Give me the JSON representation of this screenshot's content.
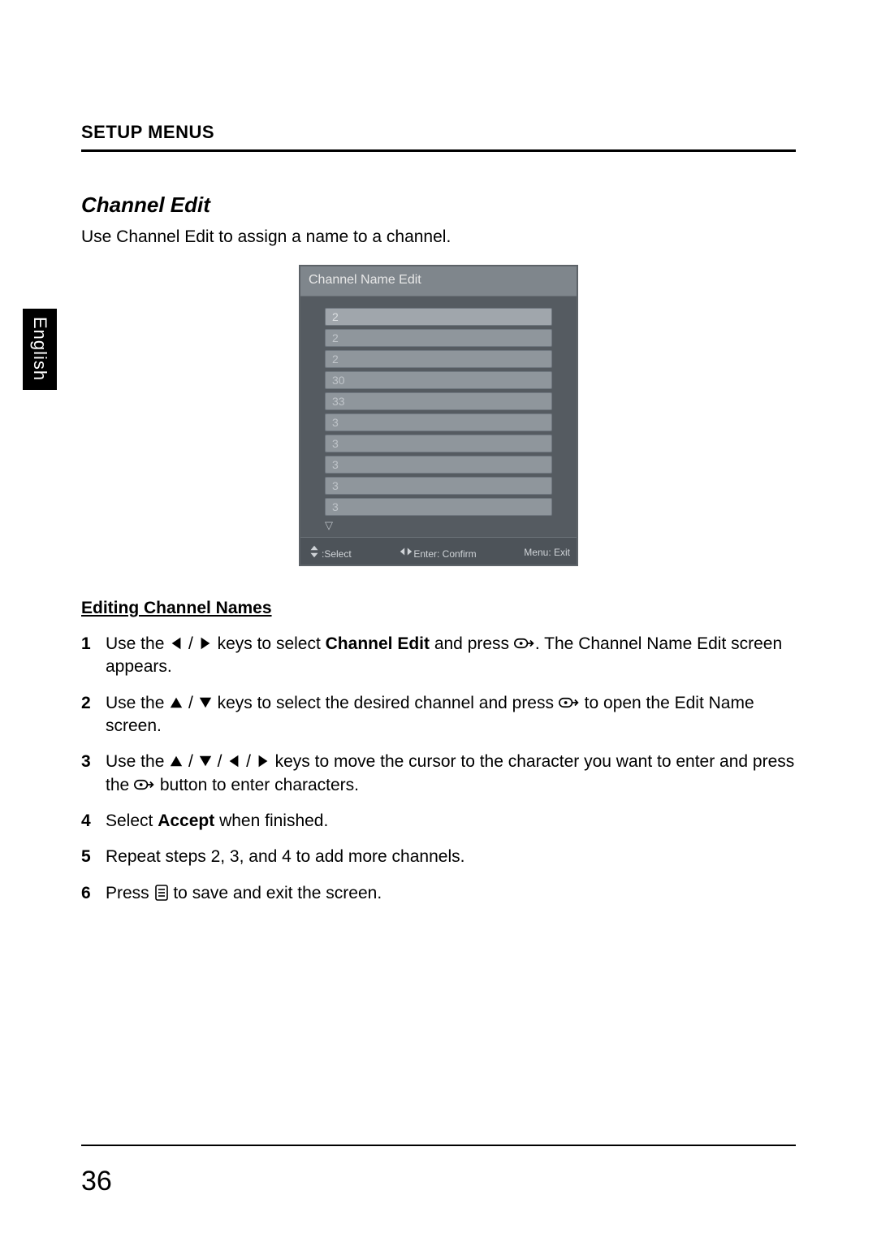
{
  "header": {
    "label": "SETUP MENUS"
  },
  "sideTab": {
    "label": "English"
  },
  "section": {
    "title": "Channel Edit",
    "intro": "Use Channel Edit to assign a name to a channel."
  },
  "osd": {
    "title": "Channel Name Edit",
    "rows": [
      "2",
      "2",
      "2",
      "30",
      "33",
      "3",
      "3",
      "3",
      "3",
      "3"
    ],
    "footer": {
      "selectLabel": ":Select",
      "enterLabel": "Enter: Confirm",
      "menuLabel": "Menu: Exit"
    }
  },
  "subheading": "Editing Channel Names",
  "steps": {
    "s1a": "Use the ",
    "s1b": " keys to select ",
    "s1bold": "Channel Edit",
    "s1c": " and press ",
    "s1d": ". The Channel Name Edit screen appears.",
    "s2a": "Use the ",
    "s2b": " keys to select the desired channel and press ",
    "s2c": " to open the Edit Name screen.",
    "s3a": "Use the ",
    "s3b": " keys to move the cursor to the character you want to enter and press the ",
    "s3c": " button to enter characters.",
    "s4a": "Select ",
    "s4bold": "Accept",
    "s4b": " when finished.",
    "s5": "Repeat steps 2, 3, and 4 to add more channels.",
    "s6a": "Press ",
    "s6b": " to save and exit the screen."
  },
  "pageNumber": "36",
  "slash": " / "
}
